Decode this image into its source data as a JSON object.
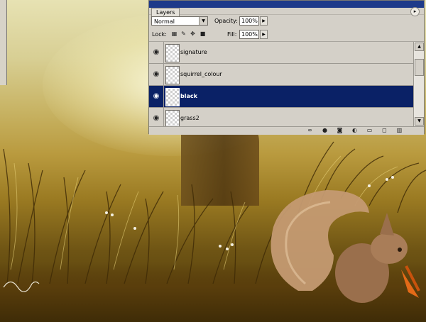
{
  "layers_panel": {
    "tab_label": "Layers",
    "blend_mode": "Normal",
    "opacity_label": "Opacity:",
    "opacity_value": "100%",
    "lock_label": "Lock:",
    "fill_label": "Fill:",
    "fill_value": "100%",
    "layers": [
      {
        "name": "signature",
        "visible": true,
        "selected": false
      },
      {
        "name": "squirrel_colour",
        "visible": true,
        "selected": false
      },
      {
        "name": "black",
        "visible": true,
        "selected": true
      },
      {
        "name": "grass2",
        "visible": true,
        "selected": false
      }
    ],
    "colors": {
      "title_bar": "#1e3a8a",
      "selection": "#0a2166",
      "panel_bg": "#d4d0c8"
    }
  },
  "icons": {
    "eye": "eye-icon",
    "lock_transparent": "lock-transparent-icon",
    "lock_paint": "brush-icon",
    "lock_move": "move-icon",
    "lock_all": "lock-icon",
    "link": "link-icon",
    "layer_style": "fx-icon",
    "mask": "mask-icon",
    "adjustment": "adjustment-icon",
    "group": "folder-icon",
    "new_layer": "new-layer-icon",
    "delete": "trash-icon"
  }
}
